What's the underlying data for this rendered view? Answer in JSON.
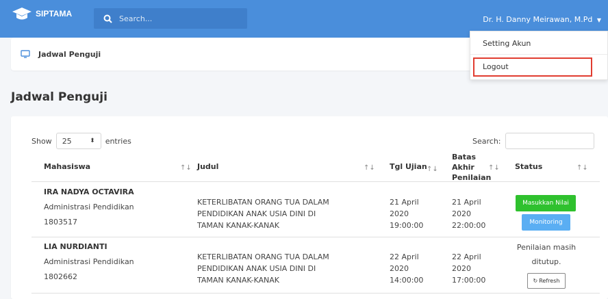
{
  "app": {
    "brand": "SIPTAMA",
    "user_name": "Dr. H. Danny Meirawan, M.Pd"
  },
  "search": {
    "placeholder": "Search..."
  },
  "breadcrumb": {
    "label": "Jadwal Penguji"
  },
  "dropdown": {
    "items": [
      "Setting Akun",
      "Logout"
    ]
  },
  "page": {
    "title": "Jadwal Penguji"
  },
  "table": {
    "show_label": "Show",
    "entries_value": "25",
    "entries_label": "entries",
    "search_label": "Search:",
    "columns": [
      "Mahasiswa",
      "Judul",
      "Tgl Ujian",
      "Batas",
      "Akhir",
      "Penilaian",
      "Status"
    ],
    "rows": [
      {
        "name": "IRA NADYA OCTAVIRA",
        "program": "Administrasi Pendidikan",
        "nim": "1803517",
        "judul": [
          "KETERLIBATAN ORANG TUA DALAM",
          "PENDIDIKAN ANAK USIA DINI DI",
          "TAMAN KANAK-KANAK"
        ],
        "tgl": [
          "21 April",
          "2020",
          "19:00:00"
        ],
        "batas": [
          "21 April",
          "2020",
          "22:00:00"
        ],
        "status_buttons": [
          "Masukkan Nilai",
          "Monitoring"
        ]
      },
      {
        "name": "LIA NURDIANTI",
        "program": "Administrasi Pendidikan",
        "nim": "1802662",
        "judul": [
          "KETERLIBATAN ORANG TUA DALAM",
          "PENDIDIKAN ANAK USIA DINI DI",
          "TAMAN KANAK-KANAK"
        ],
        "tgl": [
          "22 April",
          "2020",
          "14:00:00"
        ],
        "batas": [
          "22 April",
          "2020",
          "17:00:00"
        ],
        "status_text": [
          "Penilaian masih",
          "ditutup."
        ],
        "refresh_label": "Refresh"
      }
    ]
  },
  "colors": {
    "topbar": "#4a8edb",
    "green": "#2fc12e",
    "blue": "#5aaef3",
    "logout_highlight": "#e13c2f"
  }
}
